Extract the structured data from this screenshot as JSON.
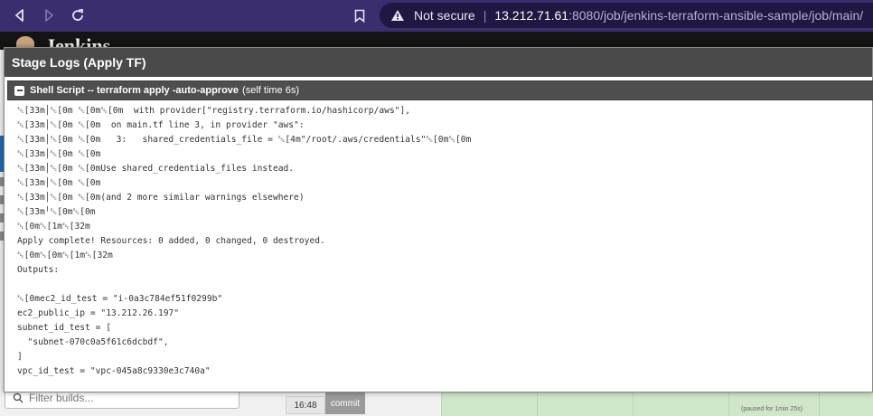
{
  "browser": {
    "not_secure_label": "Not secure",
    "url_host": "13.212.71.61",
    "url_rest": ":8080/job/jenkins-terraform-ansible-sample/job/main/"
  },
  "jenkins": {
    "logo_text": "Jenkins",
    "filter_placeholder": "Filter builds...",
    "build_time": "16:48",
    "commit_label": "commit",
    "paused_note": "(paused for 1min 25s)"
  },
  "modal": {
    "title": "Stage Logs (Apply TF)",
    "step_name": "Shell Script -- terraform apply -auto-approve",
    "self_time": "(self time 6s)",
    "log_lines": [
      "␛[33m│␛[0m ␛[0m␛[0m  with provider[\"registry.terraform.io/hashicorp/aws\"],",
      "␛[33m│␛[0m ␛[0m  on main.tf line 3, in provider \"aws\":",
      "␛[33m│␛[0m ␛[0m   3:   shared_credentials_file = ␛[4m\"/root/.aws/credentials\"␛[0m␛[0m",
      "␛[33m│␛[0m ␛[0m",
      "␛[33m│␛[0m ␛[0mUse shared_credentials_files instead.",
      "␛[33m│␛[0m ␛[0m",
      "␛[33m│␛[0m ␛[0m(and 2 more similar warnings elsewhere)",
      "␛[33m╵␛[0m␛[0m",
      "␛[0m␛[1m␛[32m",
      "Apply complete! Resources: 0 added, 0 changed, 0 destroyed.",
      "␛[0m␛[0m␛[1m␛[32m",
      "Outputs:",
      "",
      "␛[0mec2_id_test = \"i-0a3c784ef51f0299b\"",
      "ec2_public_ip = \"13.212.26.197\"",
      "subnet_id_test = [",
      "  \"subnet-070c0a5f61c6dcbdf\",",
      "]",
      "vpc_id_test = \"vpc-045a8c9330e3c740a\""
    ]
  },
  "colors": {
    "browser_bar": "#3b2d6e",
    "address_bg": "#201743",
    "modal_header": "#4a4a4a",
    "stage_success": "#cfe6c8"
  }
}
